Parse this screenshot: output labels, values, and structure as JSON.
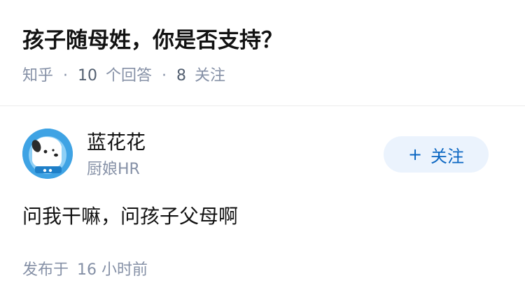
{
  "question": {
    "title": "孩子随母姓，你是否支持？",
    "source": "知乎",
    "separator": "·",
    "answer_count": "10",
    "answer_label": "个回答",
    "follower_count": "8",
    "follower_label": "关注"
  },
  "author": {
    "avatar_icon": "dog-mascot-avatar-icon",
    "name": "蓝花花",
    "headline": "厨娘HR"
  },
  "follow_button": {
    "icon": "plus-icon",
    "plus": "+",
    "label": "关注"
  },
  "answer": {
    "text": "问我干嘛，问孩子父母啊",
    "published_label": "发布于",
    "published_time": "16 小时前"
  },
  "colors": {
    "accent": "#0a66c2",
    "follow_bg": "#ebf3fd",
    "meta": "#8590a6",
    "text": "#121212",
    "avatar_bg": "#3fa3e4"
  }
}
